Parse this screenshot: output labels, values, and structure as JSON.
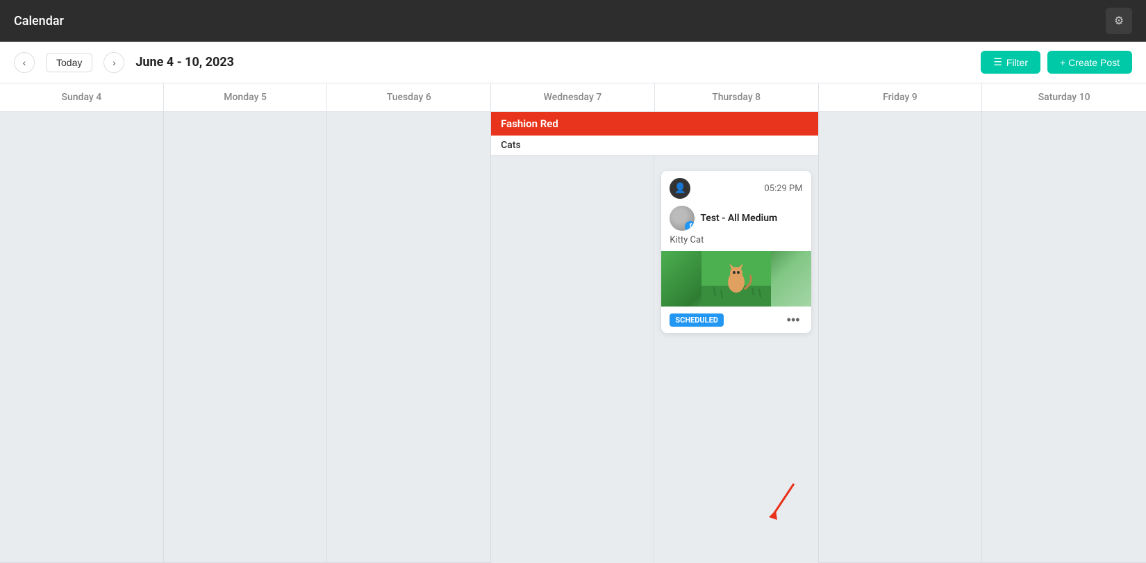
{
  "topNav": {
    "title": "Calendar",
    "settingsIcon": "⚙"
  },
  "subHeader": {
    "prevArrow": "‹",
    "nextArrow": "›",
    "todayLabel": "Today",
    "dateRange": "June 4 - 10, 2023",
    "filterLabel": "Filter",
    "createPostLabel": "+ Create Post"
  },
  "days": [
    {
      "label": "Sunday 4"
    },
    {
      "label": "Monday 5"
    },
    {
      "label": "Tuesday 6"
    },
    {
      "label": "Wednesday 7"
    },
    {
      "label": "Thursday 8"
    },
    {
      "label": "Friday 9"
    },
    {
      "label": "Saturday 10"
    }
  ],
  "eventBanner": {
    "title": "Fashion Red",
    "subLabel": "Cats"
  },
  "postCard": {
    "time": "05:29 PM",
    "profileName": "Test - All Medium",
    "caption": "Kitty Cat",
    "status": "SCHEDULED",
    "moreIcon": "•••"
  }
}
